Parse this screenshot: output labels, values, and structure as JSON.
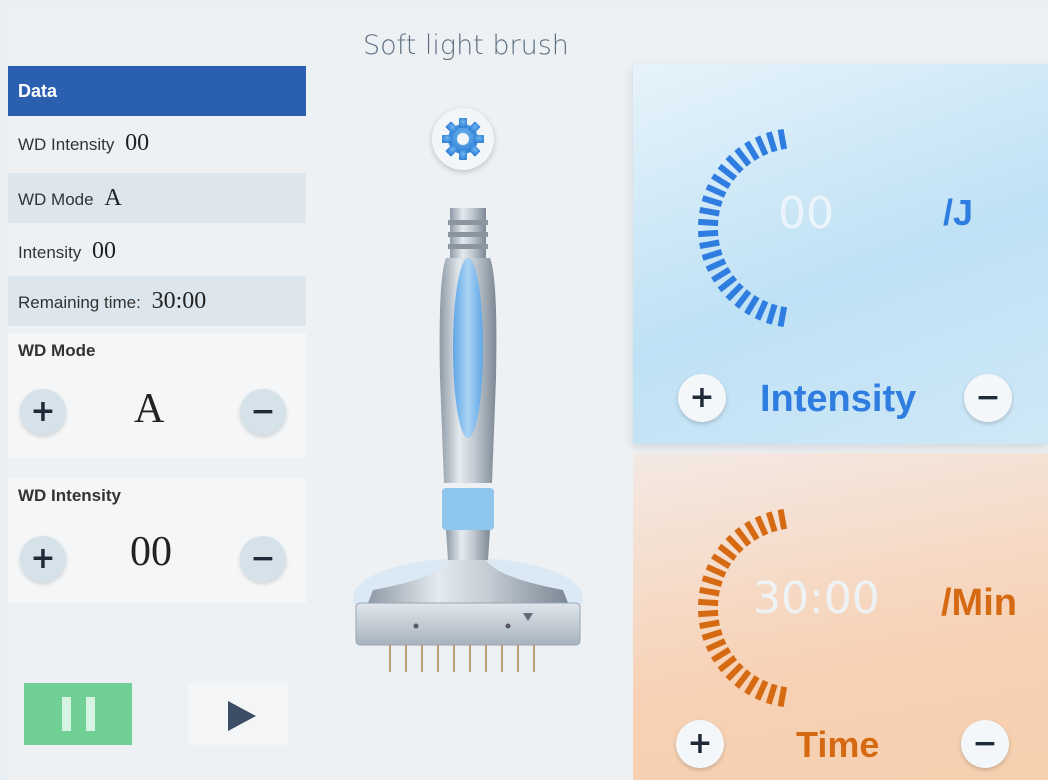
{
  "app": {
    "title": "Soft light brush"
  },
  "data_panel": {
    "header": "Data",
    "wd_intensity_label": "WD Intensity",
    "wd_intensity_value": "00",
    "wd_mode_label": "WD Mode",
    "wd_mode_value": "A",
    "intensity_label": "Intensity",
    "intensity_value": "00",
    "remaining_label": "Remaining time:",
    "remaining_value": "30:00"
  },
  "wd_mode_control": {
    "label": "WD Mode",
    "value": "A",
    "plus": "+",
    "minus": "−"
  },
  "wd_intensity_control": {
    "label": "WD Intensity",
    "value": "00",
    "plus": "+",
    "minus": "−"
  },
  "playback": {
    "pause_icon": "pause-icon",
    "play_icon": "play-icon"
  },
  "settings": {
    "icon": "gear-icon"
  },
  "intensity_card": {
    "value": "00",
    "unit": "/J",
    "label": "Intensity",
    "plus": "+",
    "minus": "−",
    "color": "#2f7de0"
  },
  "time_card": {
    "value": "30:00",
    "unit": "/Min",
    "label": "Time",
    "plus": "+",
    "minus": "−",
    "color": "#d66a12"
  },
  "colors": {
    "header_blue": "#2b5fb0",
    "pause_green": "#6fcf95",
    "accent_blue": "#2f7de0",
    "accent_orange": "#d66a12"
  }
}
